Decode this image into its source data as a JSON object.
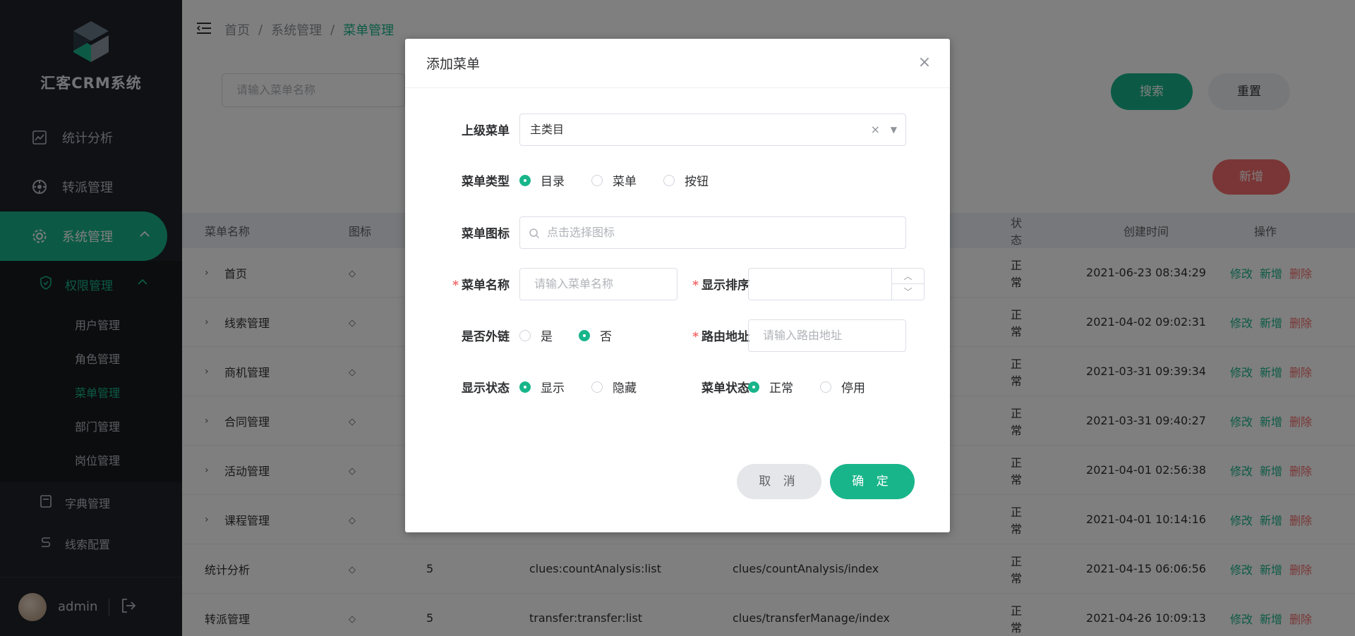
{
  "app": {
    "title": "汇客CRM系统"
  },
  "sidebar": {
    "items": [
      {
        "label": "统计分析",
        "icon": "chart-icon"
      },
      {
        "label": "转派管理",
        "icon": "transfer-icon"
      },
      {
        "label": "系统管理",
        "icon": "gear-icon"
      }
    ],
    "submenu_title": "权限管理",
    "submenu": [
      {
        "label": "用户管理"
      },
      {
        "label": "角色管理"
      },
      {
        "label": "菜单管理"
      },
      {
        "label": "部门管理"
      },
      {
        "label": "岗位管理"
      }
    ],
    "extra": [
      {
        "label": "字典管理",
        "icon": "dictionary-icon"
      },
      {
        "label": "线索配置",
        "icon": "clue-config-icon"
      }
    ],
    "user": {
      "name": "admin"
    }
  },
  "breadcrumb": [
    "首页",
    "系统管理",
    "菜单管理"
  ],
  "search": {
    "placeholder": "请输入菜单名称",
    "search_label": "搜索",
    "reset_label": "重置"
  },
  "toolbar": {
    "add_label": "新增"
  },
  "table": {
    "headers": [
      "菜单名称",
      "图标",
      "状态",
      "创建时间",
      "操作"
    ],
    "ops": {
      "edit": "修改",
      "add": "新增",
      "delete": "删除"
    },
    "rows": [
      {
        "name": "首页",
        "order": "",
        "perm": "",
        "path": "",
        "status": "正常",
        "time": "2021-06-23 08:34:29",
        "expandable": true
      },
      {
        "name": "线索管理",
        "order": "",
        "perm": "",
        "path": "",
        "status": "正常",
        "time": "2021-04-02 09:02:31",
        "expandable": true
      },
      {
        "name": "商机管理",
        "order": "",
        "perm": "",
        "path": "",
        "status": "正常",
        "time": "2021-03-31 09:39:34",
        "expandable": true
      },
      {
        "name": "合同管理",
        "order": "",
        "perm": "",
        "path": "",
        "status": "正常",
        "time": "2021-03-31 09:40:27",
        "expandable": true
      },
      {
        "name": "活动管理",
        "order": "",
        "perm": "",
        "path": "",
        "status": "正常",
        "time": "2021-04-01 02:56:38",
        "expandable": true
      },
      {
        "name": "课程管理",
        "order": "",
        "perm": "",
        "path": "",
        "status": "正常",
        "time": "2021-04-01 10:14:16",
        "expandable": true
      },
      {
        "name": "统计分析",
        "order": "5",
        "perm": "clues:countAnalysis:list",
        "path": "clues/countAnalysis/index",
        "status": "正常",
        "time": "2021-04-15 06:06:56",
        "expandable": false
      },
      {
        "name": "转派管理",
        "order": "5",
        "perm": "transfer:transfer:list",
        "path": "clues/transferManage/index",
        "status": "正常",
        "time": "2021-04-26 10:09:13",
        "expandable": false
      }
    ]
  },
  "dialog": {
    "title": "添加菜单",
    "parent_label": "上级菜单",
    "parent_value": "主类目",
    "type_label": "菜单类型",
    "type_options": [
      "目录",
      "菜单",
      "按钮"
    ],
    "type_selected": "目录",
    "icon_label": "菜单图标",
    "icon_placeholder": "点击选择图标",
    "name_label": "菜单名称",
    "name_placeholder": "请输入菜单名称",
    "order_label": "显示排序",
    "order_value": "",
    "external_label": "是否外链",
    "external_options": [
      "是",
      "否"
    ],
    "external_selected": "否",
    "route_label": "路由地址",
    "route_placeholder": "请输入路由地址",
    "visible_label": "显示状态",
    "visible_options": [
      "显示",
      "隐藏"
    ],
    "visible_selected": "显示",
    "status_label": "菜单状态",
    "status_options": [
      "正常",
      "停用"
    ],
    "status_selected": "正常",
    "cancel_label": "取 消",
    "ok_label": "确 定"
  },
  "colors": {
    "accent": "#18b58a",
    "danger": "#f56c6c",
    "sidebar": "#1f2329"
  }
}
